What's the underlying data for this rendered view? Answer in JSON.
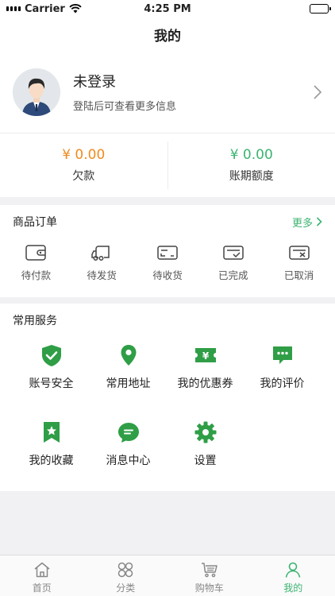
{
  "status_bar": {
    "carrier": "Carrier",
    "time": "4:25 PM"
  },
  "nav": {
    "title": "我的"
  },
  "profile": {
    "name": "未登录",
    "subtitle": "登陆后可查看更多信息"
  },
  "finance": {
    "debt": {
      "amount": "¥ 0.00",
      "label": "欠款"
    },
    "credit": {
      "amount": "¥ 0.00",
      "label": "账期额度"
    }
  },
  "orders": {
    "title": "商品订单",
    "more": "更多",
    "items": [
      {
        "label": "待付款",
        "icon": "wallet-icon"
      },
      {
        "label": "待发货",
        "icon": "truck-icon"
      },
      {
        "label": "待收货",
        "icon": "receive-icon"
      },
      {
        "label": "已完成",
        "icon": "completed-icon"
      },
      {
        "label": "已取消",
        "icon": "cancelled-icon"
      }
    ]
  },
  "services": {
    "title": "常用服务",
    "items": [
      {
        "label": "账号安全",
        "icon": "shield-icon"
      },
      {
        "label": "常用地址",
        "icon": "location-pin-icon"
      },
      {
        "label": "我的优惠券",
        "icon": "coupon-icon"
      },
      {
        "label": "我的评价",
        "icon": "comment-icon"
      },
      {
        "label": "我的收藏",
        "icon": "bookmark-icon"
      },
      {
        "label": "消息中心",
        "icon": "message-icon"
      },
      {
        "label": "设置",
        "icon": "gear-icon"
      }
    ]
  },
  "tabs": [
    {
      "label": "首页",
      "icon": "home-icon"
    },
    {
      "label": "分类",
      "icon": "category-icon"
    },
    {
      "label": "购物车",
      "icon": "cart-icon"
    },
    {
      "label": "我的",
      "icon": "profile-icon",
      "active": true
    }
  ],
  "colors": {
    "accent": "#2f9e46",
    "amount_orange": "#ef8a1e",
    "amount_green": "#3cb371",
    "tab_active": "#3cb371"
  }
}
